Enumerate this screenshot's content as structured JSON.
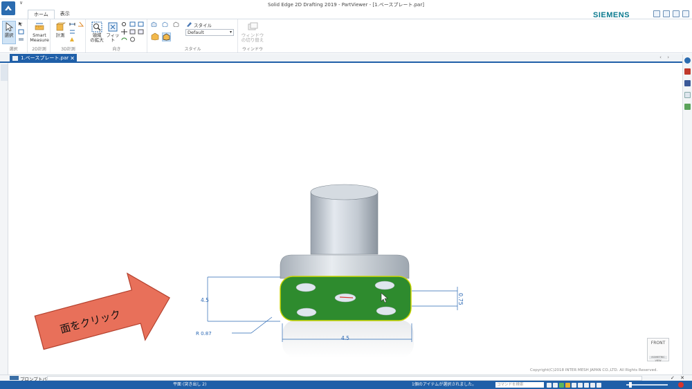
{
  "window": {
    "title": "Solid Edge 2D Drafting 2019 - PartViewer - [1.ベースプレート.par]",
    "brand": "SIEMENS",
    "qat_arrow": "∨"
  },
  "ribbon": {
    "tabs": [
      {
        "label": "ホーム",
        "active": true
      },
      {
        "label": "表示",
        "active": false
      }
    ],
    "groups": {
      "select": {
        "label": "選択",
        "button": "選択"
      },
      "measure2d": {
        "label": "2D計測",
        "button_line1": "Smart",
        "button_line2": "Measure"
      },
      "measure3d": {
        "label": "3D計測",
        "button": "計測"
      },
      "orient": {
        "label": "向き",
        "area_zoom_line1": "領域",
        "area_zoom_line2": "の拡大",
        "fit": "フィット"
      },
      "style": {
        "label": "スタイル",
        "style_label": "スタイル",
        "style_value": "Default"
      },
      "window": {
        "label": "ウィンドウ",
        "button_line1": "ウィンドウ",
        "button_line2": "の切り替え"
      }
    }
  },
  "document": {
    "tab_label": "1.ベースプレート.par",
    "close_glyph": "✕",
    "nav_glyphs": "‹ ›"
  },
  "viewport": {
    "annotation_text": "面をクリック",
    "dimensions": {
      "height": "4.5",
      "width": "4.5",
      "thickness": "0.75",
      "radius": "R 0.87"
    },
    "copyright": "Copyright(C)2018 INTER MESH JAPAN CO.,LTD. All Rights Reserved.",
    "viewcube_label": "FRONT",
    "viewcube_sub": "ISOMETRIC VIEW"
  },
  "promptbar": {
    "label": "プロンプトバー",
    "tools": "✓ ✕"
  },
  "statusbar": {
    "left_text": "平面 (突き出し 2)",
    "center_text": "1個のアイテムが選択されました。",
    "command_search_placeholder": "コマンドを検索"
  },
  "colors": {
    "accent": "#1f5fa8",
    "selected_face": "#2e8b2e",
    "face_highlight": "#c8d400",
    "dimension": "#2a67b3",
    "arrow_fill": "#e8705a"
  }
}
